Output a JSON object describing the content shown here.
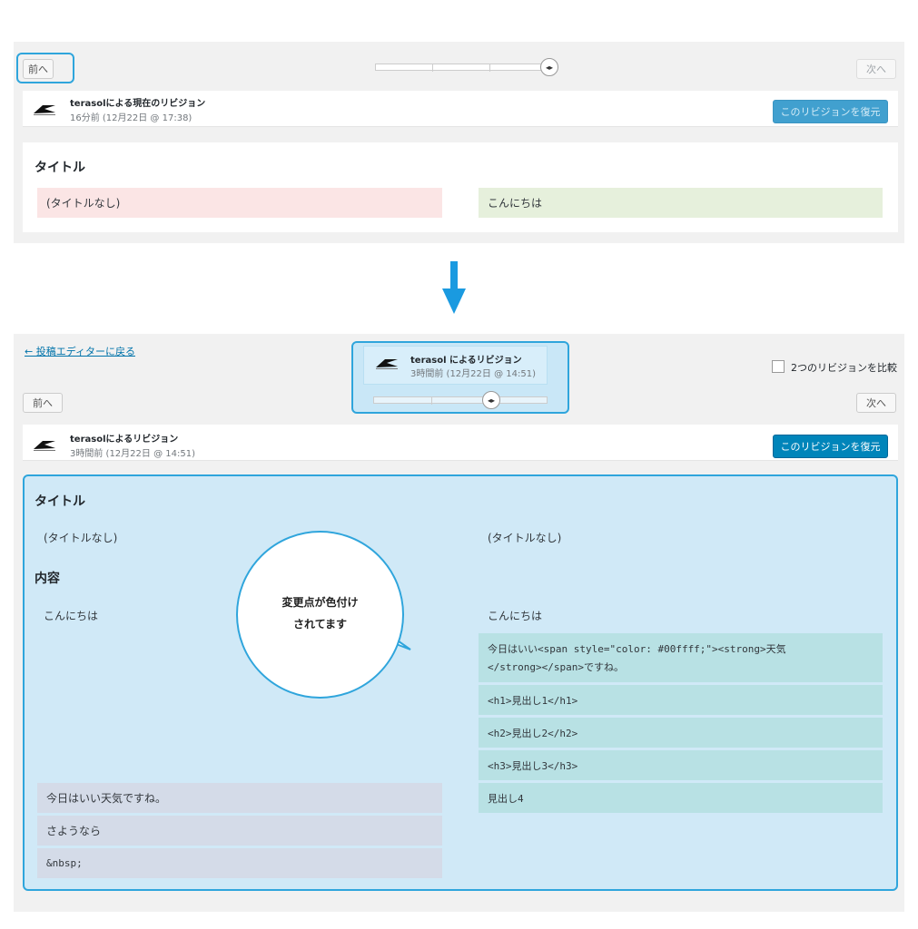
{
  "top_panel": {
    "prev_label": "前へ",
    "next_label": "次へ",
    "author_line": "terasolによる現在のリビジョン",
    "time_line": "16分前 (12月22日 @ 17:38)",
    "restore_label": "このリビジョンを復元",
    "field_title": "タイトル",
    "left_value": "(タイトルなし)",
    "right_value": "こんにちは",
    "handle_glyph": "◂▸"
  },
  "bottom_panel": {
    "back_link": "← 投稿エディターに戻る",
    "tooltip_author": "terasol によるリビジョン",
    "tooltip_time": "3時間前 (12月22日 @ 14:51)",
    "compare_label": "2つのリビジョンを比較",
    "prev_label": "前へ",
    "next_label": "次へ",
    "author_line": "terasolによるリビジョン",
    "time_line": "3時間前 (12月22日 @ 14:51)",
    "restore_label": "このリビジョンを復元",
    "handle_glyph": "◂▸",
    "field_title": "タイトル",
    "title_left": "(タイトルなし)",
    "title_right": "(タイトルなし)",
    "field_content": "内容",
    "content_left_1": "こんにちは",
    "content_right_1": "こんにちは",
    "right_changed": [
      "今日はいい<span style=\"color: #00ffff;\"><strong>天気",
      "</strong></span>ですね。",
      "<h1>見出し1</h1>",
      "<h2>見出し2</h2>",
      "<h3>見出し3</h3>",
      "見出し4"
    ],
    "left_changed": [
      "今日はいい天気ですね。",
      "さようなら",
      "&nbsp;"
    ],
    "bubble_line1": "変更点が色付け",
    "bubble_line2": "されてます"
  },
  "colors": {
    "accent": "#0085ba",
    "highlight_border": "#2fa5dc",
    "arrow": "#1a9ae0",
    "deleted": "#fbe5e5",
    "inserted": "#e6f0dc"
  },
  "icons": {
    "arrow": "down-arrow-icon",
    "avatar": "terasol-logo-icon",
    "checkbox": "checkbox-icon"
  }
}
